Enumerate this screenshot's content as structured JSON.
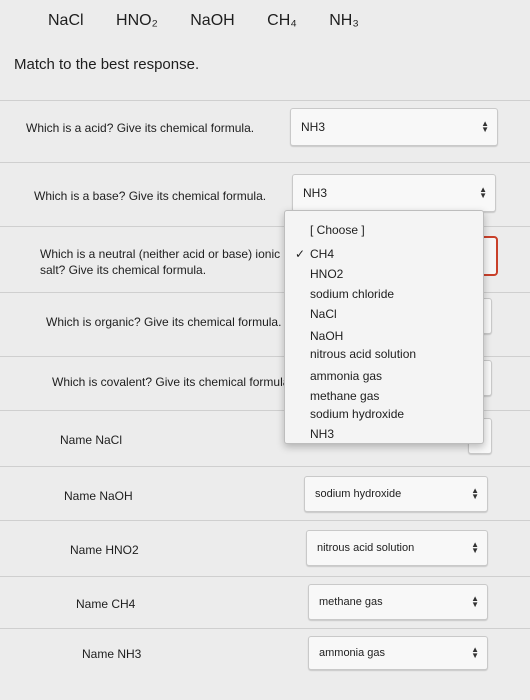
{
  "header": {
    "items": [
      "NaCl",
      "HNO₂",
      "NaOH",
      "CH₄",
      "NH₃"
    ]
  },
  "prompt": "Match to the best response.",
  "questions": [
    {
      "label": "Which is a acid? Give its chemical formula.",
      "selected": "NH3"
    },
    {
      "label": "Which is a base? Give its chemical formula.",
      "selected": "NH3"
    },
    {
      "label": "Which is a neutral (neither acid or base) ionic salt? Give its chemical formula.",
      "selected": ""
    },
    {
      "label": "Which is organic? Give its chemical formula.",
      "selected": ""
    },
    {
      "label": "Which is covalent? Give its chemical formula",
      "selected": ""
    },
    {
      "label": "Name NaCl",
      "selected": ""
    },
    {
      "label": "Name NaOH",
      "selected": "sodium hydroxide"
    },
    {
      "label": "Name HNO2",
      "selected": "nitrous acid solution"
    },
    {
      "label": "Name CH4",
      "selected": "methane gas"
    },
    {
      "label": "Name NH3",
      "selected": "ammonia gas"
    }
  ],
  "dropdown": {
    "options": [
      "[ Choose ]",
      "CH4",
      "HNO2",
      "sodium chloride",
      "NaCl",
      "NaOH",
      "nitrous acid solution",
      "ammonia gas",
      "methane gas",
      "sodium hydroxide",
      "NH3"
    ],
    "checked": "✓"
  },
  "icons": {
    "arrow_up": "▲",
    "arrow_down": "▼"
  }
}
